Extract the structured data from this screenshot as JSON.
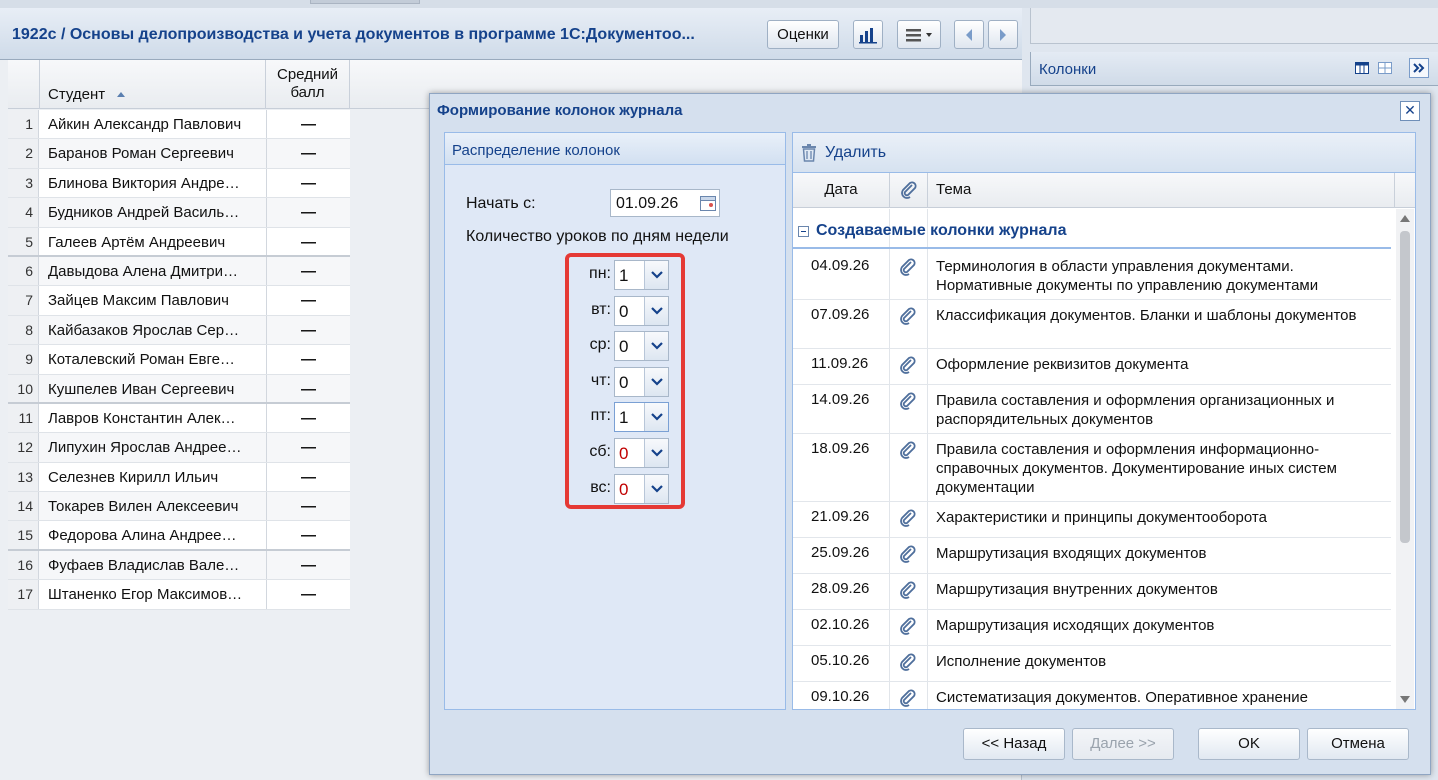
{
  "journal": {
    "title": "1922с / Основы делопроизводства и учета документов в программе 1С:Документоо...",
    "grades_button": "Оценки",
    "columns": {
      "student": "Студент",
      "avg_line1": "Средний",
      "avg_line2": "балл"
    },
    "students": [
      {
        "n": "1",
        "name": "Айкин Александр Павлович",
        "avg": "—"
      },
      {
        "n": "2",
        "name": "Баранов Роман Сергеевич",
        "avg": "—"
      },
      {
        "n": "3",
        "name": "Блинова Виктория Андре…",
        "avg": "—"
      },
      {
        "n": "4",
        "name": "Будников Андрей Василь…",
        "avg": "—"
      },
      {
        "n": "5",
        "name": "Галеев Артём Андреевич",
        "avg": "—"
      },
      {
        "n": "6",
        "name": "Давыдова Алена Дмитри…",
        "avg": "—"
      },
      {
        "n": "7",
        "name": "Зайцев Максим Павлович",
        "avg": "—"
      },
      {
        "n": "8",
        "name": "Кайбазаков Ярослав Сер…",
        "avg": "—"
      },
      {
        "n": "9",
        "name": "Коталевский Роман Евге…",
        "avg": "—"
      },
      {
        "n": "10",
        "name": "Кушпелев Иван Сергеевич",
        "avg": "—"
      },
      {
        "n": "11",
        "name": "Лавров Константин Алек…",
        "avg": "—"
      },
      {
        "n": "12",
        "name": "Липухин Ярослав Андрее…",
        "avg": "—"
      },
      {
        "n": "13",
        "name": "Селезнев Кирилл Ильич",
        "avg": "—"
      },
      {
        "n": "14",
        "name": "Токарев Вилен Алексеевич",
        "avg": "—"
      },
      {
        "n": "15",
        "name": "Федорова Алина Андрее…",
        "avg": "—"
      },
      {
        "n": "16",
        "name": "Фуфаев Владислав Вале…",
        "avg": "—"
      },
      {
        "n": "17",
        "name": "Штаненко Егор Максимов…",
        "avg": "—"
      }
    ]
  },
  "side_panel": {
    "title": "Колонки"
  },
  "dialog": {
    "title": "Формирование колонок журнала",
    "left_panel": {
      "title": "Распределение колонок",
      "start_label": "Начать с:",
      "start_value": "01.09.26",
      "lessons_label": "Количество уроков по дням недели",
      "days": [
        {
          "label": "пн:",
          "value": "1",
          "red": false
        },
        {
          "label": "вт:",
          "value": "0",
          "red": false
        },
        {
          "label": "ср:",
          "value": "0",
          "red": false
        },
        {
          "label": "чт:",
          "value": "0",
          "red": false
        },
        {
          "label": "пт:",
          "value": "1",
          "red": false
        },
        {
          "label": "сб:",
          "value": "0",
          "red": true
        },
        {
          "label": "вс:",
          "value": "0",
          "red": true
        }
      ]
    },
    "right_panel": {
      "delete_label": "Удалить",
      "col_date": "Дата",
      "col_topic": "Тема",
      "group_title": "Создаваемые колонки журнала",
      "rows": [
        {
          "date": "04.09.26",
          "topic": "Терминология в области управления документами. Нормативные документы по управлению документами"
        },
        {
          "date": "07.09.26",
          "topic": "Классификация документов. Бланки и шаблоны документов"
        },
        {
          "date": "11.09.26",
          "topic": "Оформление реквизитов документа"
        },
        {
          "date": "14.09.26",
          "topic": "Правила составления и оформления организационных и распорядительных документов"
        },
        {
          "date": "18.09.26",
          "topic": "Правила составления и оформления информационно-справочных документов. Документирование иных систем документации"
        },
        {
          "date": "21.09.26",
          "topic": "Характеристики и принципы документооборота"
        },
        {
          "date": "25.09.26",
          "topic": "Маршрутизация входящих документов"
        },
        {
          "date": "28.09.26",
          "topic": "Маршрутизация внутренних документов"
        },
        {
          "date": "02.10.26",
          "topic": "Маршрутизация исходящих документов"
        },
        {
          "date": "05.10.26",
          "topic": "Исполнение документов"
        },
        {
          "date": "09.10.26",
          "topic": "Систематизация документов. Оперативное хранение"
        }
      ]
    },
    "buttons": {
      "back": "<< Назад",
      "next": "Далее >>",
      "ok": "OK",
      "cancel": "Отмена"
    }
  },
  "colors": {
    "title_blue": "#15428b",
    "highlight_red": "#e53935",
    "weekend_red": "#c00000"
  }
}
